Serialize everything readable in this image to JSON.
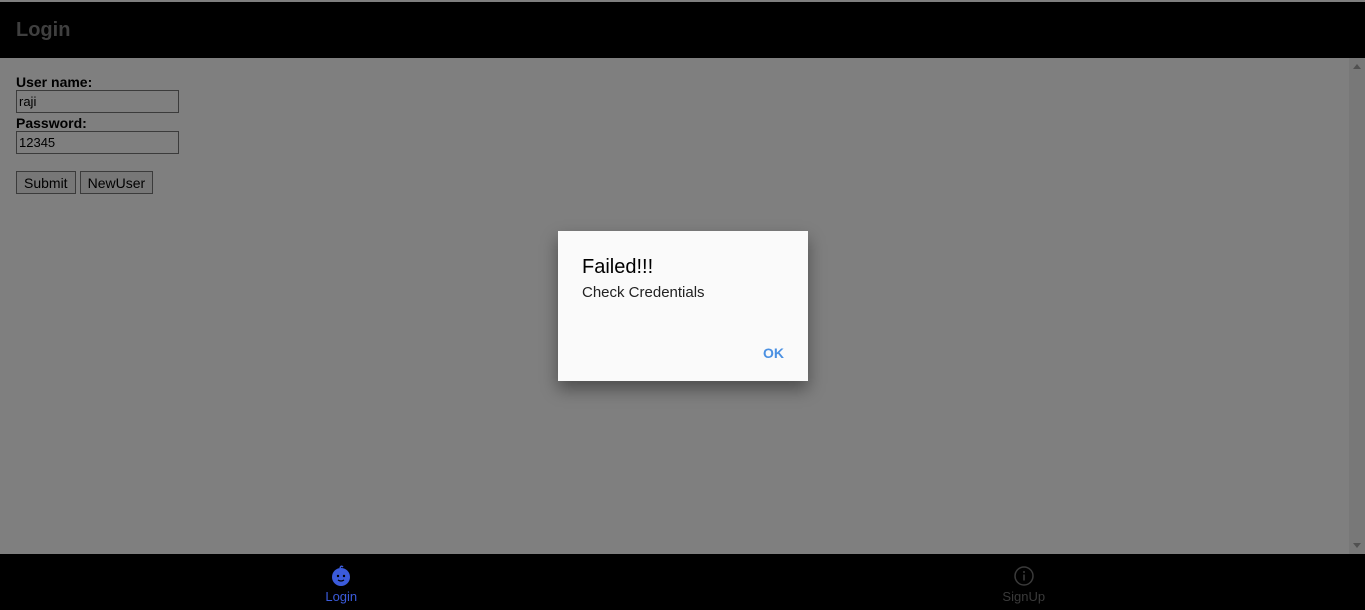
{
  "header": {
    "title": "Login"
  },
  "form": {
    "username_label": "User name:",
    "username_value": "raji",
    "password_label": "Password:",
    "password_value": "12345",
    "submit_label": "Submit",
    "newuser_label": "NewUser"
  },
  "tabs": [
    {
      "label": "Login",
      "icon": "baby-face-icon",
      "active": true,
      "color": "#3b5bdb"
    },
    {
      "label": "SignUp",
      "icon": "info-icon",
      "active": false,
      "color": "#3a3a3a"
    }
  ],
  "dialog": {
    "title": "Failed!!!",
    "message": "Check Credentials",
    "ok_label": "OK"
  },
  "colors": {
    "header_bg": "#000000",
    "accent": "#4a90e2"
  }
}
